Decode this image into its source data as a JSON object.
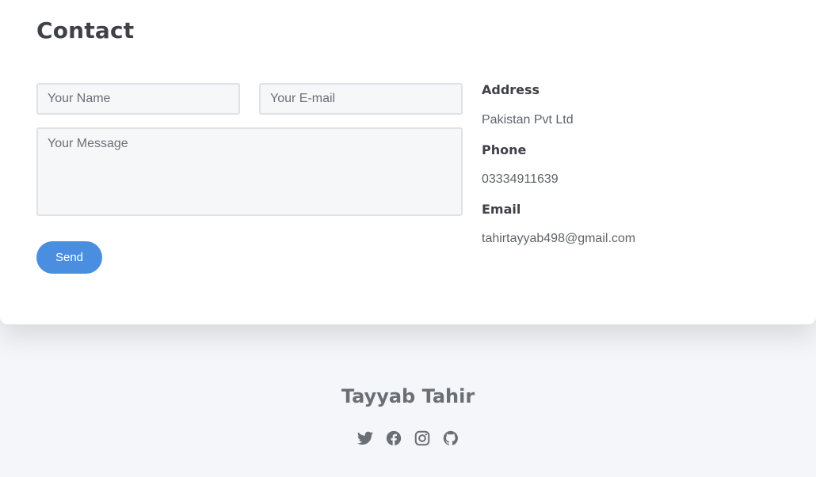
{
  "contact": {
    "title": "Contact",
    "form": {
      "name_placeholder": "Your Name",
      "email_placeholder": "Your E-mail",
      "message_placeholder": "Your Message",
      "send_label": "Send"
    },
    "info": {
      "address_label": "Address",
      "address_value": "Pakistan Pvt Ltd",
      "phone_label": "Phone",
      "phone_value": "03334911639",
      "email_label": "Email",
      "email_value": "tahirtayyab498@gmail.com"
    }
  },
  "footer": {
    "name": "Tayyab Tahir",
    "social_icons": [
      "twitter-icon",
      "facebook-icon",
      "instagram-icon",
      "github-icon"
    ],
    "icon_color": "#6a6e75"
  },
  "colors": {
    "accent": "#4a8ee0",
    "page_background": "#f5f6f9",
    "card_background": "#ffffff"
  }
}
